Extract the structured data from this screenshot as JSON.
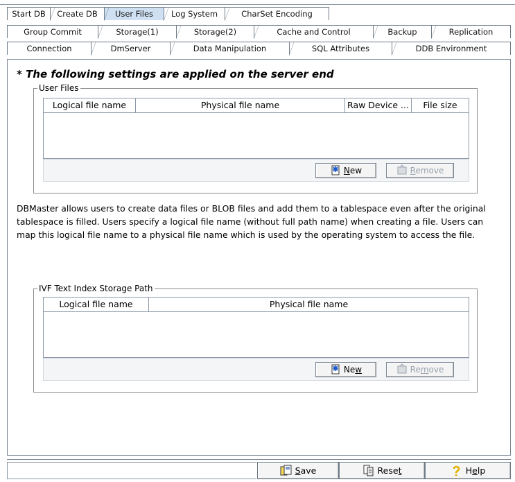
{
  "tabs": {
    "row1": [
      "Start DB",
      "Create DB",
      "User Files",
      "Log System",
      "CharSet Encoding"
    ],
    "row2": [
      "Group Commit",
      "Storage(1)",
      "Storage(2)",
      "Cache and Control",
      "Backup",
      "Replication"
    ],
    "row3": [
      "Connection",
      "DmServer",
      "Data Manipulation",
      "SQL Attributes",
      "DDB Environment"
    ],
    "selected": "User Files"
  },
  "heading": "* The following settings are applied on the server end",
  "user_files": {
    "group_label": "User Files",
    "columns": [
      "Logical file name",
      "Physical file name",
      "Raw Device ...",
      "File size"
    ],
    "rows": [],
    "new_label_u": "N",
    "new_label_rest": "ew",
    "remove_label_u": "R",
    "remove_label_rest": "emove"
  },
  "description": "DBMaster allows users to create data files or BLOB files and add them to  a tablespace even after the original tablespace is filled. Users  specify a logical file name (without full path name) when creating a  file. Users can map this logical file name to a physical file name which is used by the operating system to access the file.",
  "ivf": {
    "group_label": "IVF Text Index Storage Path",
    "columns": [
      "Logical file name",
      "Physical file name"
    ],
    "rows": [],
    "new_label_pre": "Ne",
    "new_label_u": "w",
    "remove_label_pre": "Re",
    "remove_label_u": "m",
    "remove_label_rest": "ove"
  },
  "footer": {
    "save_u": "S",
    "save_rest": "ave",
    "reset_pre": "Rese",
    "reset_u": "t",
    "help_pre": "H",
    "help_u": "e",
    "help_rest": "lp"
  },
  "icons": {
    "new": "new-file-icon",
    "remove": "remove-icon",
    "save": "save-icon",
    "reset": "reset-icon",
    "help": "help-icon"
  },
  "colors": {
    "selected_tab": "#cfe0f2",
    "border": "#7c8794",
    "toolbar_bg": "#f3f5f7",
    "disabled_text": "#9aa3ad"
  }
}
